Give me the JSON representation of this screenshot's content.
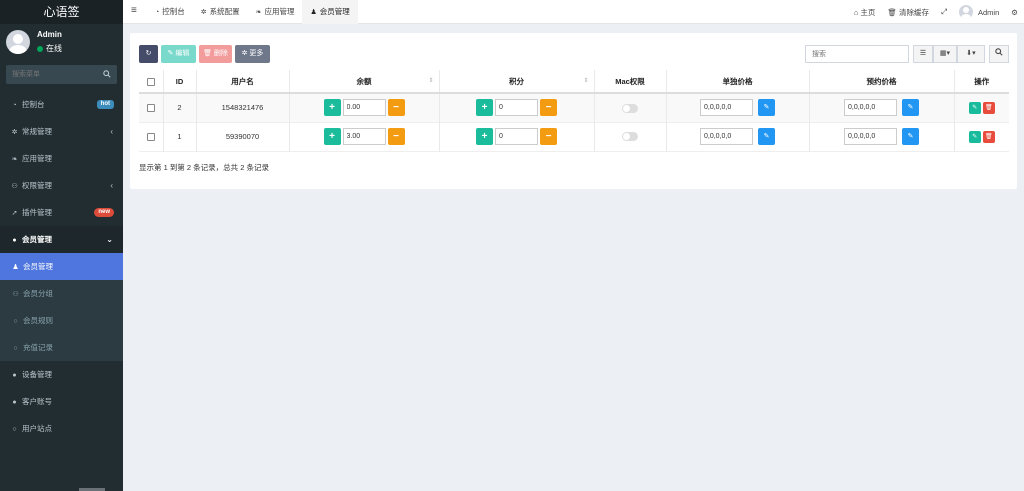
{
  "app": {
    "logo_text": "心语签"
  },
  "user": {
    "name": "Admin",
    "status": "在线"
  },
  "sidebar": {
    "search_placeholder": "搜索菜单",
    "items": [
      {
        "label": "控制台",
        "icon": "dashboard-icon",
        "badge": "hot"
      },
      {
        "label": "常规管理",
        "icon": "cogs-icon",
        "chevron": "‹"
      },
      {
        "label": "应用管理",
        "icon": "leaf-icon"
      },
      {
        "label": "权限管理",
        "icon": "group-icon",
        "chevron": "‹"
      },
      {
        "label": "插件管理",
        "icon": "rocket-icon",
        "badge": "new"
      },
      {
        "label": "会员管理",
        "icon": "user-circle-icon",
        "chevron": "⌄"
      }
    ],
    "subitems": [
      {
        "label": "会员管理",
        "icon": "user-icon"
      },
      {
        "label": "会员分组",
        "icon": "users-icon"
      },
      {
        "label": "会员规则",
        "icon": "circle-icon"
      },
      {
        "label": "充值记录",
        "icon": "circle-icon"
      }
    ],
    "items_after": [
      {
        "label": "设备管理",
        "icon": "device-icon"
      },
      {
        "label": "客户账号",
        "icon": "account-icon"
      },
      {
        "label": "用户站点",
        "icon": "circle-icon"
      }
    ]
  },
  "topbar": {
    "tabs": [
      {
        "label": "控制台",
        "icon": "dashboard-icon"
      },
      {
        "label": "系统配置",
        "icon": "gear-icon"
      },
      {
        "label": "应用管理",
        "icon": "leaf-icon"
      },
      {
        "label": "会员管理",
        "icon": "user-icon"
      }
    ],
    "home": "主页",
    "clear_cache": "清除缓存",
    "admin": "Admin"
  },
  "toolbar": {
    "edit": "编辑",
    "delete": "删除",
    "more": "更多",
    "search_placeholder": "搜索"
  },
  "table": {
    "headers": [
      "ID",
      "用户名",
      "余额",
      "积分",
      "Mac权限",
      "单独价格",
      "预约价格",
      "操作"
    ],
    "rows": [
      {
        "id": "2",
        "username": "1548321476",
        "balance": "0.00",
        "points": "0",
        "mac": false,
        "price": "0,0,0,0,0",
        "reserve": "0,0,0,0,0"
      },
      {
        "id": "1",
        "username": "59390070",
        "balance": "3.00",
        "points": "0",
        "mac": false,
        "price": "0,0,0,0,0",
        "reserve": "0,0,0,0,0"
      }
    ],
    "summary": "显示第 1 到第 2 条记录，总共 2 条记录"
  },
  "colors": {
    "sidebar": "#222d32",
    "active_sub": "#4e76de",
    "plus": "#1abc9c",
    "minus": "#f39c12"
  }
}
